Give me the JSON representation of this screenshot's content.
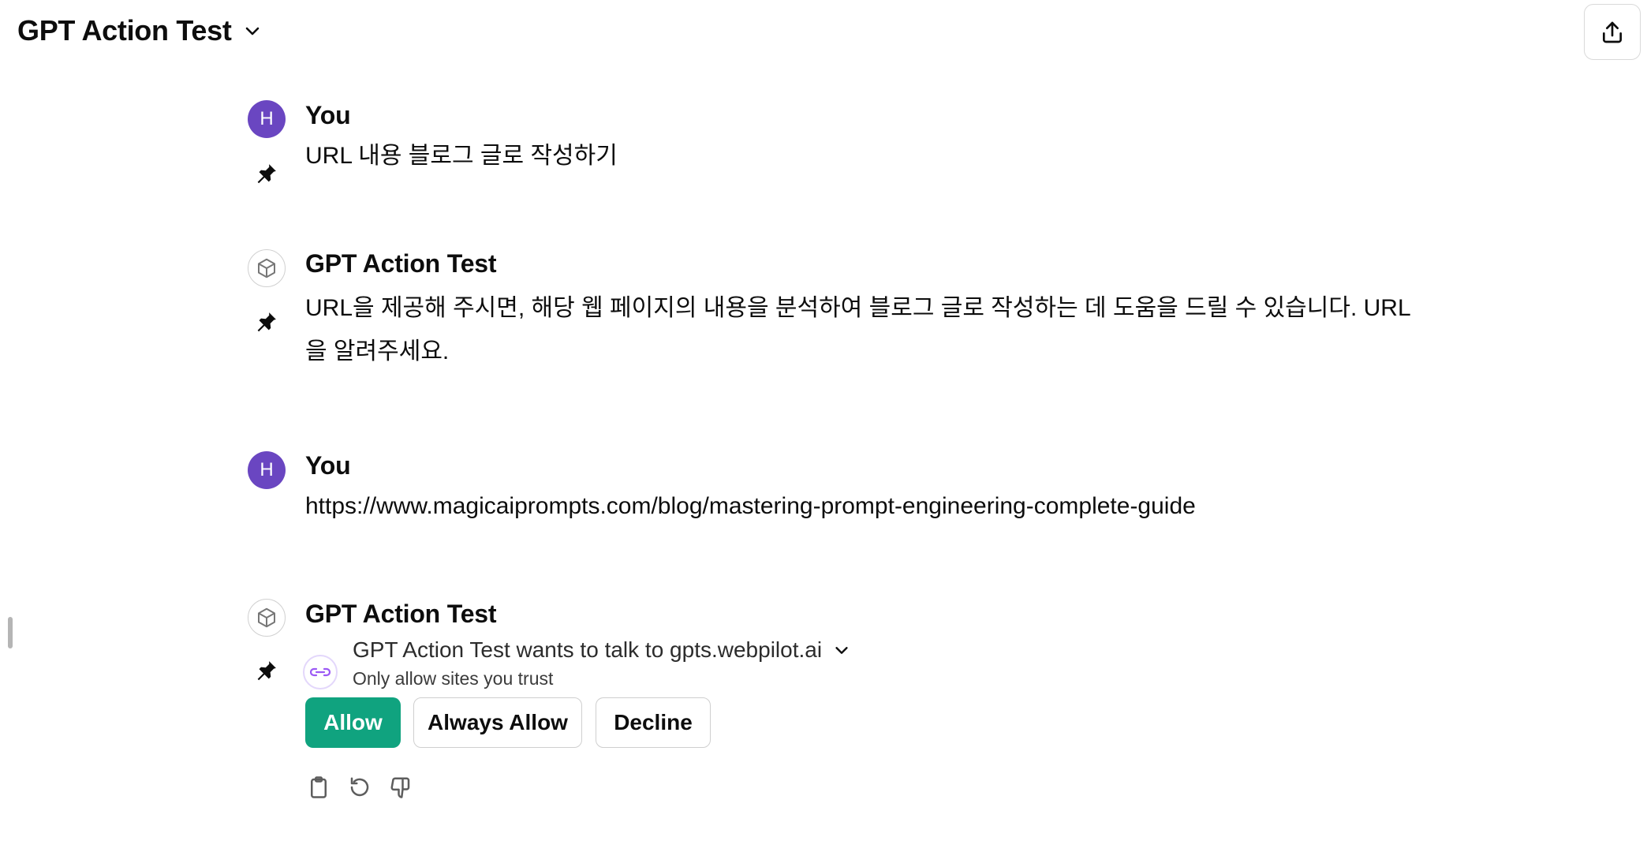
{
  "header": {
    "title": "GPT Action Test"
  },
  "messages": [
    {
      "author": "You",
      "avatar_letter": "H",
      "text": "URL 내용 블로그 글로 작성하기"
    },
    {
      "author": "GPT Action Test",
      "text_line1": "URL을 제공해 주시면, 해당 웹 페이지의 내용을 분석하여 블로그 글로 작성하는 데 도움을 드릴 수 있습니다. URL",
      "text_line2": "을 알려주세요."
    },
    {
      "author": "You",
      "avatar_letter": "H",
      "text": "https://www.magicaiprompts.com/blog/mastering-prompt-engineering-complete-guide"
    },
    {
      "author": "GPT Action Test"
    }
  ],
  "action_request": {
    "title": "GPT Action Test wants to talk to gpts.webpilot.ai",
    "subtitle": "Only allow sites you trust",
    "buttons": {
      "allow": "Allow",
      "always_allow": "Always Allow",
      "decline": "Decline"
    }
  },
  "colors": {
    "user_avatar": "#6a46c1",
    "allow_button": "#10a37f",
    "action_icon": "#9b59f5"
  },
  "icons": [
    "chevron-down-icon",
    "share-icon",
    "pin-icon",
    "gpt-cube-icon",
    "link-icon",
    "clipboard-icon",
    "regenerate-icon",
    "thumbs-down-icon"
  ]
}
